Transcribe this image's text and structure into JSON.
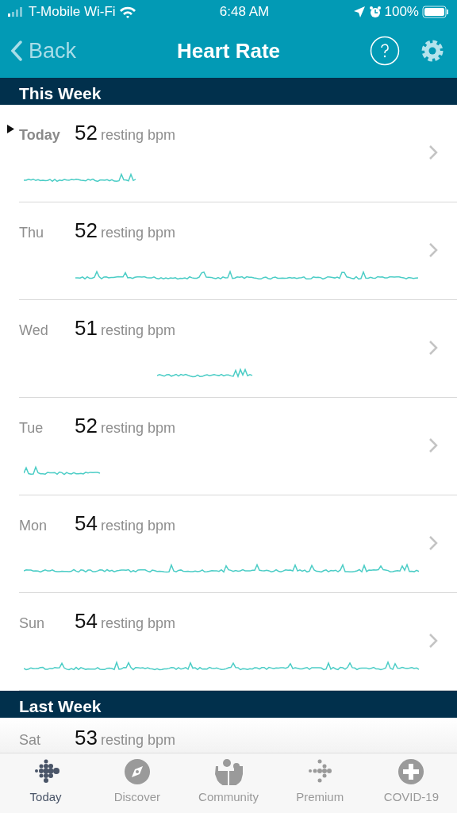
{
  "status_bar": {
    "carrier": "T-Mobile Wi-Fi",
    "time": "6:48 AM",
    "battery": "100%"
  },
  "header": {
    "back": "Back",
    "title": "Heart Rate"
  },
  "sections": [
    {
      "title": "This Week",
      "days": [
        {
          "day": "Today",
          "value": "52",
          "unit": "resting bpm",
          "selected": true
        },
        {
          "day": "Thu",
          "value": "52",
          "unit": "resting bpm",
          "selected": false
        },
        {
          "day": "Wed",
          "value": "51",
          "unit": "resting bpm",
          "selected": false
        },
        {
          "day": "Tue",
          "value": "52",
          "unit": "resting bpm",
          "selected": false
        },
        {
          "day": "Mon",
          "value": "54",
          "unit": "resting bpm",
          "selected": false
        },
        {
          "day": "Sun",
          "value": "54",
          "unit": "resting bpm",
          "selected": false
        }
      ]
    },
    {
      "title": "Last Week",
      "days": [
        {
          "day": "Sat",
          "value": "53",
          "unit": "resting bpm",
          "selected": false
        }
      ]
    }
  ],
  "tabs": [
    {
      "label": "Today",
      "selected": true
    },
    {
      "label": "Discover",
      "selected": false
    },
    {
      "label": "Community",
      "selected": false
    },
    {
      "label": "Premium",
      "selected": false
    },
    {
      "label": "COVID-19",
      "selected": false
    }
  ]
}
